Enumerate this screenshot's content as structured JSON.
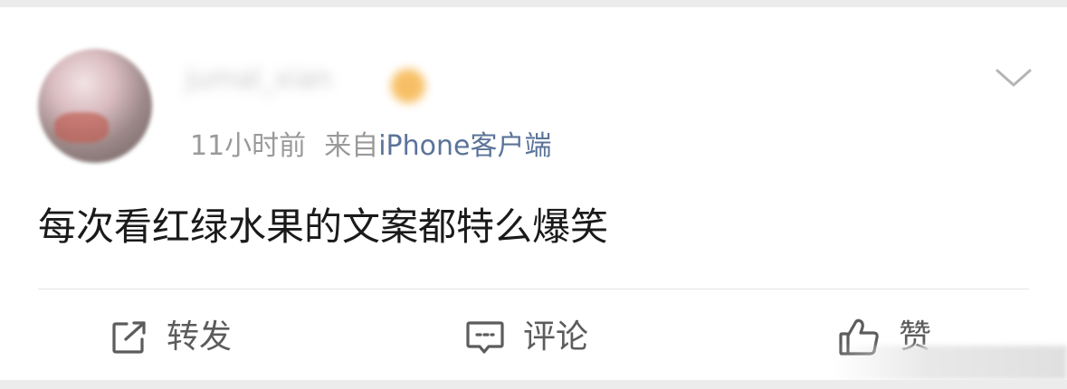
{
  "post": {
    "username": "jumal_xian",
    "time": "11小时前",
    "from_label": "来自",
    "client": "iPhone客户端",
    "text": "每次看红绿水果的文案都特么爆笑"
  },
  "actions": {
    "repost_label": "转发",
    "comment_label": "评论",
    "like_label": "赞"
  },
  "icons": {
    "more": "chevron-down-icon",
    "repost": "repost-icon",
    "comment": "comment-icon",
    "like": "thumbs-up-icon"
  },
  "colors": {
    "client_link": "#5b7399",
    "meta_text": "#9a9a9a",
    "post_text": "#1a1a1a",
    "action_text": "#5c5c5c"
  }
}
